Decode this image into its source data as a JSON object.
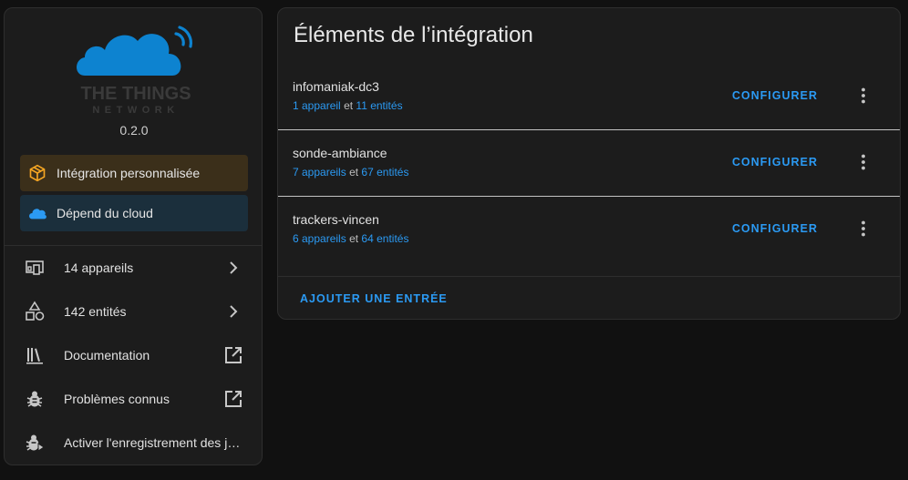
{
  "integration": {
    "logo_line1": "THE THINGS",
    "logo_line2": "NETWORK",
    "version": "0.2.0",
    "badges": {
      "custom": "Intégration personnalisée",
      "cloud": "Dépend du cloud"
    },
    "links": [
      {
        "label": "14 appareils",
        "icon": "devices-icon",
        "trail": "chevron-right-icon"
      },
      {
        "label": "142 entités",
        "icon": "shapes-icon",
        "trail": "chevron-right-icon"
      },
      {
        "label": "Documentation",
        "icon": "library-icon",
        "trail": "open-in-new-icon"
      },
      {
        "label": "Problèmes connus",
        "icon": "bug-icon",
        "trail": "open-in-new-icon"
      },
      {
        "label": "Activer l'enregistrement des journaux de débogage",
        "icon": "bug-play-icon",
        "trail": ""
      }
    ]
  },
  "entries_card": {
    "title": "Éléments de l’intégration",
    "connector": "et",
    "configure_label": "CONFIGURER",
    "add_entry_label": "AJOUTER UNE ENTRÉE",
    "entries": [
      {
        "name": "infomaniak-dc3",
        "devices": "1 appareil",
        "entities": "11 entités"
      },
      {
        "name": "sonde-ambiance",
        "devices": "7 appareils",
        "entities": "67 entités"
      },
      {
        "name": "trackers-vincen",
        "devices": "6 appareils",
        "entities": "64 entités"
      }
    ]
  },
  "colors": {
    "background": "#111111",
    "card": "#1c1c1c",
    "accent": "#2b9af3",
    "custom_badge_bg": "#3b2f1a",
    "custom_badge_icon": "#f6a623",
    "cloud_badge_bg": "#1b2f3c",
    "logo_blue": "#0d83d0"
  }
}
